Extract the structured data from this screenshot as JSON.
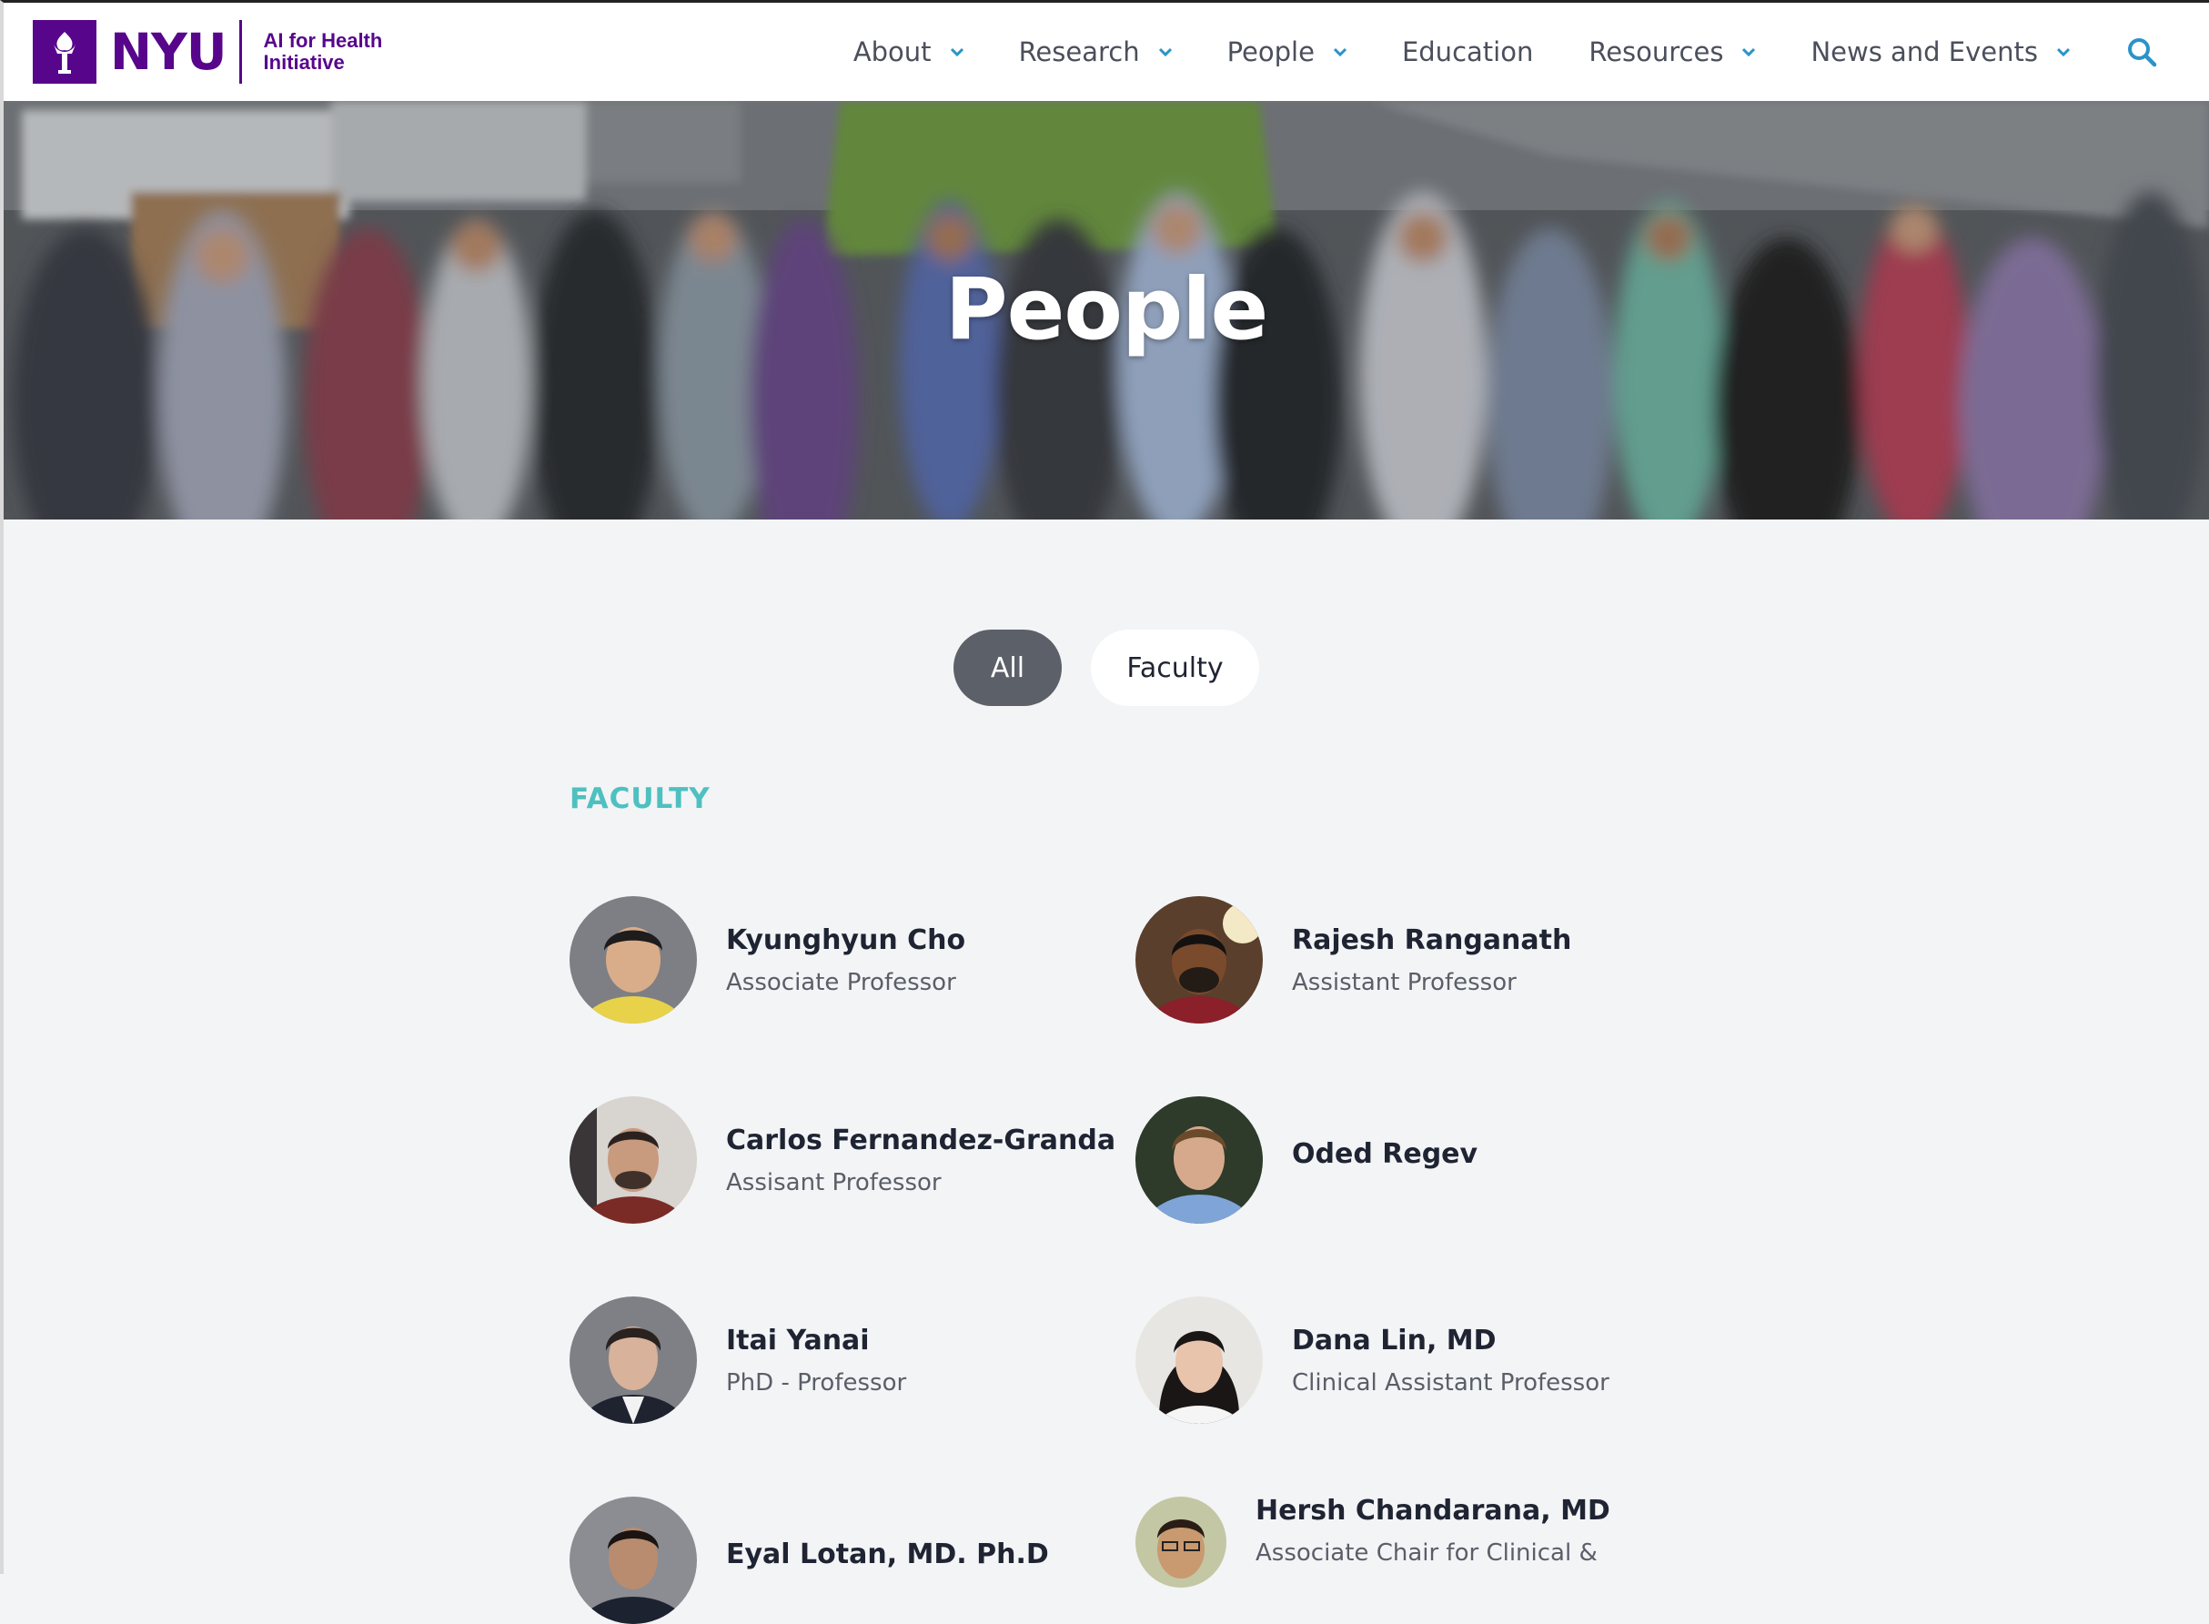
{
  "brand": {
    "logo_word": "NYU",
    "logo_sub": "AI for Health Initiative",
    "color": "#57068c"
  },
  "nav": {
    "items": [
      {
        "label": "About",
        "dropdown": true
      },
      {
        "label": "Research",
        "dropdown": true
      },
      {
        "label": "People",
        "dropdown": true
      },
      {
        "label": "Education",
        "dropdown": false
      },
      {
        "label": "Resources",
        "dropdown": true
      },
      {
        "label": "News and Events",
        "dropdown": true
      }
    ],
    "search_icon": "search-icon",
    "accent": "#2b93c9"
  },
  "hero": {
    "title": "People"
  },
  "filters": [
    {
      "label": "All",
      "active": true
    },
    {
      "label": "Faculty",
      "active": false
    }
  ],
  "section": {
    "title": "FACULTY",
    "color": "#4ec0c0"
  },
  "people": [
    {
      "name": "Kyunghyun Cho",
      "role": "Associate Professor"
    },
    {
      "name": "Rajesh Ranganath",
      "role": "Assistant Professor"
    },
    {
      "name": "Carlos Fernandez-Granda",
      "role": "Assisant Professor"
    },
    {
      "name": "Oded Regev",
      "role": ""
    },
    {
      "name": "Itai Yanai",
      "role": "PhD - Professor"
    },
    {
      "name": "Dana Lin, MD",
      "role": "Clinical Assistant Professor"
    },
    {
      "name": "Eyal Lotan, MD. Ph.D",
      "role": ""
    },
    {
      "name": "Hersh Chandarana, MD",
      "role": "Associate Chair for Clinical &"
    }
  ]
}
